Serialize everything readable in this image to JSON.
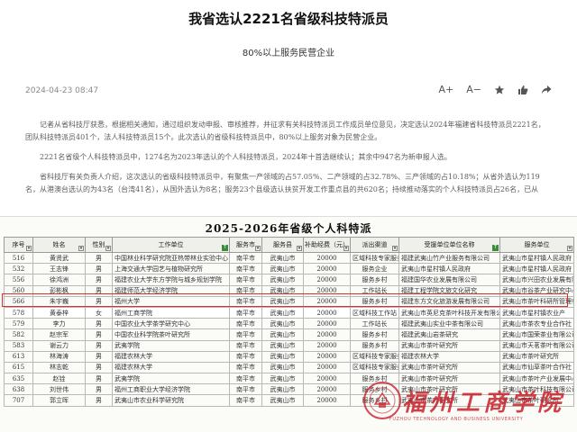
{
  "article": {
    "headline": "我省选认2221名省级科技特派员",
    "subtitle": "80%以上服务民营企业",
    "date": "2024-04-23 08:47",
    "toolbar": {
      "font_up": "A+",
      "font_down": "A−"
    },
    "paragraphs": [
      "记者从省科技厅获悉，根据相关通知，通过组织发动申报、审核推荐，并征求有关科技特派员工作成员单位意见，决定选认2024年福建省科技特派员2221名，团队科技特派员401个，法人科技特派员15个。此次选认的省级科技特派员中，80%以上服务对象为民营企业。",
      "2221名省级个人科技特派员中，1274名为2023年选认的个人科技特派员，2024年十首选继续认；其余中947名为新申报人选。",
      "省科技厅有关负责人介绍，这次选认的省级科技特派员中，有聚焦一产领域的占57.05%、二产领域的占32.78%、三产领域的占10.18%；从省外选认为119名，从港澳台选认的为43名（台湾41名），从国外选认为8名；服务23个县级选认扶贫开发工作重点县的共620名；持续推动落实的个人科技特派员占26名，已从"
    ]
  },
  "document": {
    "title": "2025-2026年省级个人科特派",
    "columns": [
      "序号",
      "姓名",
      "性别",
      "工作单位",
      "服务市",
      "服务县",
      "补助经费（元）",
      "派出渠道",
      "受援单位单位名称",
      "服务单位"
    ],
    "rows": [
      [
        "516",
        "黄贤武",
        "男",
        "中国林业科学研究院亚热带林业实验中心",
        "南平市",
        "武夷山市",
        "20000",
        "区域科技专家服务团",
        "福建武夷山竹产业服务有限公司",
        "武夷山市星村镇人民政府"
      ],
      [
        "532",
        "王志锋",
        "男",
        "上海交通大学园艺与植物研究所",
        "南平市",
        "武夷山市",
        "20000",
        "服务企业",
        "武夷山市星村镇人民政府",
        "武夷山市星村镇人民政府"
      ],
      [
        "556",
        "徐鸿洲",
        "男",
        "福建农业大学东方学院与城乡规划学院",
        "南平市",
        "武夷山市",
        "20000",
        "服务乡村",
        "福建国华农业发展有限公司",
        "武夷山市兴田农业发展有限公司"
      ],
      [
        "560",
        "彭彬枫",
        "男",
        "福建师范大学经济学院",
        "南平市",
        "武夷山市",
        "20000",
        "工作站长",
        "福建工程学院文旅文化研究",
        "武夷山市谷茶产业研究中心"
      ],
      [
        "566",
        "朱宇巍",
        "男",
        "福州大学",
        "南平市",
        "武夷山市",
        "20000",
        "服务乡村",
        "福建东方文化旅游发展有限公司",
        "武夷山市茶叶科研所管理有限公司"
      ],
      [
        "578",
        "黄泰梓",
        "女",
        "福州工商学院",
        "南平市",
        "武夷山市",
        "20000",
        "区域科技工作站",
        "武夷山市英尼克茶叶科技开发有限公司",
        "武夷山市星村镇农业产"
      ],
      [
        "579",
        "李力",
        "男",
        "中国农业大学茶学研究中心",
        "南平市",
        "武夷山市",
        "20000",
        "工作站长",
        "福建武夷山实业中茶有限公司",
        "武夷山市茶农专业合作社"
      ],
      [
        "582",
        "赵宗军",
        "男",
        "中国农业科学院茶叶研究所",
        "南平市",
        "武夷山市",
        "20000",
        "服务乡村",
        "福建武夷山岩茶研究",
        "武夷山市国荣茶业有限公司"
      ],
      [
        "583",
        "谢云力",
        "男",
        "武夷学院",
        "南平市",
        "武夷山市",
        "20000",
        "服务乡村",
        "武夷山市茶叶研究所",
        "武夷山市天茗茶叶有限公司"
      ],
      [
        "613",
        "林海涛",
        "男",
        "福建农林大学",
        "南平市",
        "武夷山市",
        "20000",
        "区域科技专家服务团",
        "福建农林大学",
        "武夷山市茶叶研究所"
      ],
      [
        "615",
        "林志乾",
        "男",
        "福建农林大学",
        "南平市",
        "武夷山市",
        "20000",
        "区域科技专家服务团",
        "武夷山市茶叶研究所",
        "武夷山市仙草茶叶合作社"
      ],
      [
        "635",
        "赵铨",
        "男",
        "武夷学院",
        "南平市",
        "武夷山市",
        "20000",
        "服务乡村",
        "武夷山市茶叶研究所",
        "武夷山市茶叶产业发展中心"
      ],
      [
        "638",
        "刘世伟",
        "男",
        "福州工商职业大学经济学院",
        "南平市",
        "武夷山市",
        "20000",
        "服务乡村",
        "武夷山市茶叶研究所",
        "武夷山市茶叶科技有限公司"
      ],
      [
        "707",
        "郭立晖",
        "男",
        "武夷山市农业科学研究院",
        "南平市",
        "武夷山市",
        "20000",
        "服务乡村",
        "武夷山市茶叶研究所",
        "武夷山市茶叶研究所"
      ]
    ],
    "highlighted_row_index": 5,
    "watermark": {
      "text": "福州工商学院",
      "subtext": "FUZHOU TECHNOLOGY AND BUSINESS UNIVERSITY"
    }
  },
  "colors": {
    "highlight": "#d9302b",
    "badge_green": "#3d8b3d",
    "watermark": "#c81e28"
  },
  "icons": [
    "font-increase-icon",
    "font-decrease-icon",
    "favorite-star-icon",
    "like-thumb-icon",
    "share-icon",
    "filter-dropdown-icon"
  ]
}
